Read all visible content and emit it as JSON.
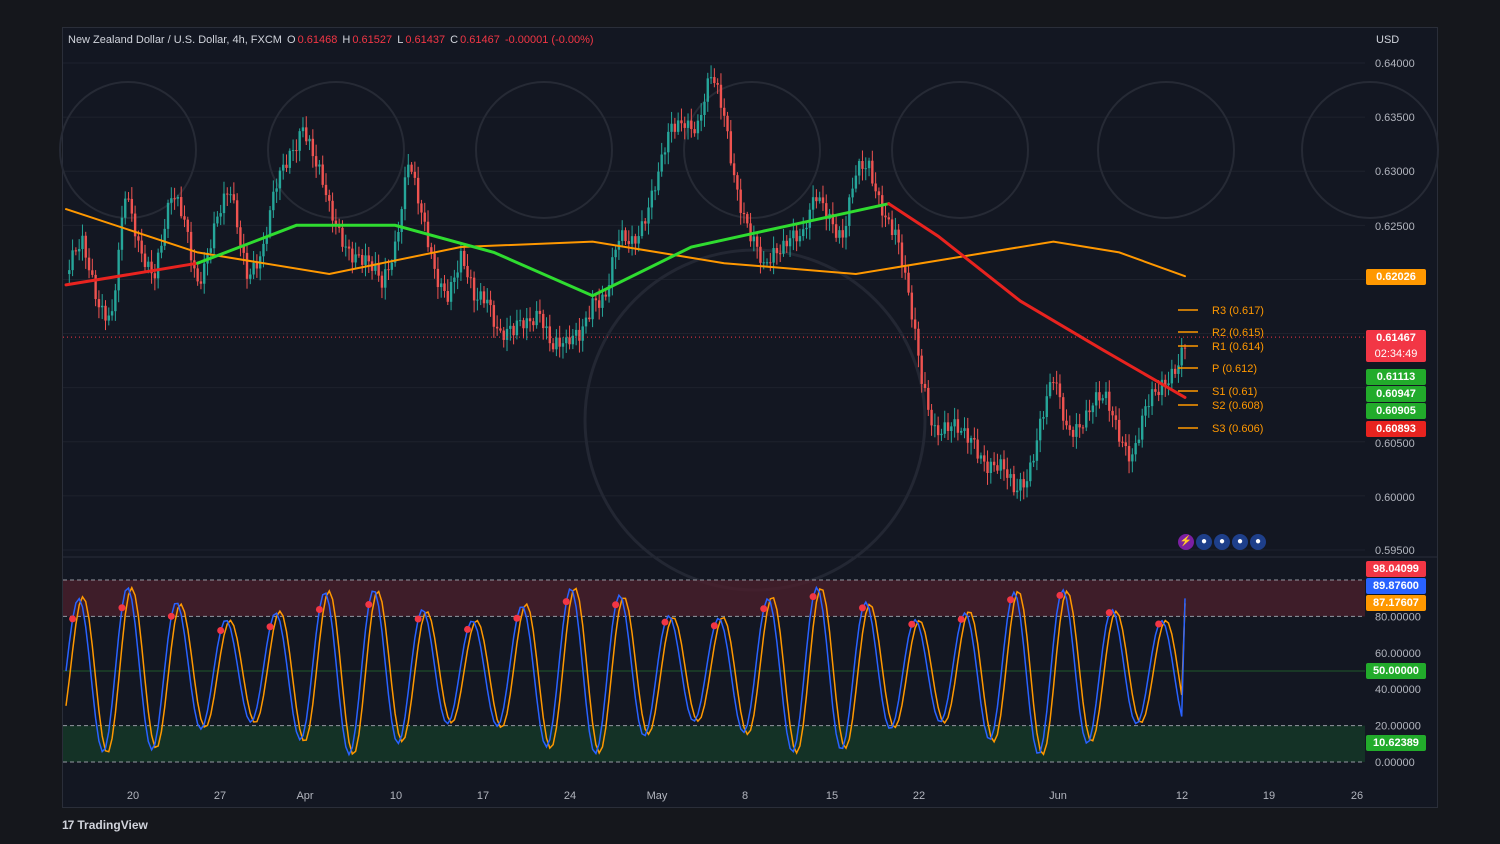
{
  "header": {
    "symbol": "New Zealand Dollar / U.S. Dollar, 4h, FXCM",
    "open_label": "O",
    "open": "0.61468",
    "high_label": "H",
    "high": "0.61527",
    "low_label": "L",
    "low": "0.61437",
    "close_label": "C",
    "close": "0.61467",
    "change": "-0.00001 (-0.00%)"
  },
  "currency": "USD",
  "branding": "TradingView",
  "colors": {
    "background": "#131722",
    "up": "#26a69a",
    "down": "#ef5350",
    "ma_green": "#2fdc30",
    "ma_red": "#e8231f",
    "ma_orange": "#ff9800",
    "stoch_k": "#2962ff",
    "stoch_d": "#ff9800",
    "overbought_zone": "#4a1f2c",
    "oversold_zone": "#153a28"
  },
  "price_axis": {
    "ticks": [
      "0.64000",
      "0.63500",
      "0.63000",
      "0.62500",
      "0.62000",
      "0.61500",
      "0.61000",
      "0.60500",
      "0.60000",
      "0.59500"
    ],
    "labels": [
      "0.64000",
      "0.63500",
      "0.63000",
      "0.62500",
      "0.60500",
      "0.60000",
      "0.59500"
    ]
  },
  "price_badges": [
    {
      "label": "0.62026",
      "color": "#ff9800"
    },
    {
      "label": "0.61467",
      "sub": "02:34:49",
      "color": "#f23645"
    },
    {
      "label": "0.61113",
      "color": "#22ab2b"
    },
    {
      "label": "0.60947",
      "color": "#22ab2b"
    },
    {
      "label": "0.60905",
      "color": "#22ab2b"
    },
    {
      "label": "0.60893",
      "color": "#e8231f"
    }
  ],
  "pivots": [
    {
      "name": "R3",
      "label": "R3 (0.617)",
      "value": 0.617
    },
    {
      "name": "R2",
      "label": "R2 (0.615)",
      "value": 0.615
    },
    {
      "name": "R1",
      "label": "R1 (0.614)",
      "value": 0.614
    },
    {
      "name": "P",
      "label": "P (0.612)",
      "value": 0.612
    },
    {
      "name": "S1",
      "label": "S1 (0.61)",
      "value": 0.61
    },
    {
      "name": "S2",
      "label": "S2 (0.608)",
      "value": 0.608
    },
    {
      "name": "S3",
      "label": "S3 (0.606)",
      "value": 0.606
    }
  ],
  "stoch_axis": {
    "labels": [
      "80.00000",
      "60.00000",
      "40.00000",
      "20.00000",
      "0.00000"
    ]
  },
  "stoch_badges": [
    {
      "label": "98.04099",
      "color": "#f23645"
    },
    {
      "label": "89.87600",
      "color": "#2962ff"
    },
    {
      "label": "87.17607",
      "color": "#ff9800"
    },
    {
      "label": "50.00000",
      "color": "#22ab2b"
    },
    {
      "label": "10.62389",
      "color": "#22ab2b"
    }
  ],
  "time_axis": [
    "20",
    "27",
    "Apr",
    "10",
    "17",
    "24",
    "May",
    "8",
    "15",
    "22",
    "Jun",
    "12",
    "19",
    "26"
  ],
  "chart_data": {
    "type": "candlestick",
    "title": "New Zealand Dollar / U.S. Dollar, 4h, FXCM",
    "ylim": [
      0.5945,
      0.6405
    ],
    "x_labels": [
      "20",
      "27",
      "Apr",
      "10",
      "17",
      "24",
      "May",
      "8",
      "15",
      "22",
      "Jun",
      "12",
      "19",
      "26"
    ],
    "close_path": [
      [
        0,
        0.6205
      ],
      [
        5,
        0.6225
      ],
      [
        10,
        0.6185
      ],
      [
        14,
        0.617
      ],
      [
        18,
        0.627
      ],
      [
        22,
        0.623
      ],
      [
        27,
        0.6215
      ],
      [
        32,
        0.627
      ],
      [
        36,
        0.625
      ],
      [
        40,
        0.6205
      ],
      [
        45,
        0.6245
      ],
      [
        50,
        0.6275
      ],
      [
        55,
        0.6215
      ],
      [
        60,
        0.6225
      ],
      [
        64,
        0.628
      ],
      [
        68,
        0.632
      ],
      [
        72,
        0.635
      ],
      [
        76,
        0.63
      ],
      [
        80,
        0.626
      ],
      [
        84,
        0.6245
      ],
      [
        88,
        0.6225
      ],
      [
        92,
        0.6205
      ],
      [
        96,
        0.6195
      ],
      [
        100,
        0.624
      ],
      [
        104,
        0.631
      ],
      [
        108,
        0.625
      ],
      [
        112,
        0.621
      ],
      [
        116,
        0.6195
      ],
      [
        120,
        0.6215
      ],
      [
        124,
        0.6175
      ],
      [
        128,
        0.619
      ],
      [
        132,
        0.6155
      ],
      [
        136,
        0.6145
      ],
      [
        140,
        0.6155
      ],
      [
        144,
        0.618
      ],
      [
        148,
        0.614
      ],
      [
        152,
        0.613
      ],
      [
        156,
        0.615
      ],
      [
        160,
        0.619
      ],
      [
        164,
        0.618
      ],
      [
        168,
        0.623
      ],
      [
        172,
        0.624
      ],
      [
        176,
        0.6265
      ],
      [
        180,
        0.629
      ],
      [
        184,
        0.6335
      ],
      [
        188,
        0.6355
      ],
      [
        192,
        0.6345
      ],
      [
        196,
        0.638
      ],
      [
        200,
        0.635
      ],
      [
        204,
        0.629
      ],
      [
        208,
        0.624
      ],
      [
        212,
        0.62
      ],
      [
        216,
        0.623
      ],
      [
        220,
        0.625
      ],
      [
        224,
        0.6235
      ],
      [
        228,
        0.627
      ],
      [
        232,
        0.6265
      ],
      [
        236,
        0.6245
      ],
      [
        240,
        0.629
      ],
      [
        244,
        0.63
      ],
      [
        248,
        0.6275
      ],
      [
        252,
        0.6245
      ],
      [
        256,
        0.6175
      ],
      [
        260,
        0.611
      ],
      [
        264,
        0.607
      ],
      [
        268,
        0.606
      ],
      [
        272,
        0.605
      ],
      [
        276,
        0.6055
      ],
      [
        280,
        0.6035
      ],
      [
        284,
        0.602
      ],
      [
        288,
        0.6
      ],
      [
        292,
        0.6025
      ],
      [
        296,
        0.607
      ],
      [
        300,
        0.61
      ],
      [
        304,
        0.606
      ],
      [
        308,
        0.6075
      ],
      [
        312,
        0.6085
      ],
      [
        316,
        0.608
      ],
      [
        320,
        0.606
      ],
      [
        324,
        0.6045
      ],
      [
        328,
        0.6075
      ],
      [
        332,
        0.609
      ],
      [
        336,
        0.612
      ],
      [
        340,
        0.6147
      ]
    ],
    "moving_averages": [
      {
        "name": "long",
        "color": "#ff9800",
        "path": [
          [
            0,
            0.6265
          ],
          [
            40,
            0.6225
          ],
          [
            80,
            0.6205
          ],
          [
            120,
            0.623
          ],
          [
            160,
            0.6235
          ],
          [
            200,
            0.6215
          ],
          [
            240,
            0.6205
          ],
          [
            280,
            0.6225
          ],
          [
            300,
            0.6235
          ],
          [
            320,
            0.6225
          ],
          [
            340,
            0.6203
          ]
        ]
      },
      {
        "name": "mid",
        "path": [
          [
            0,
            0.6195
          ],
          [
            40,
            0.6215
          ],
          [
            70,
            0.625
          ],
          [
            100,
            0.625
          ],
          [
            130,
            0.6225
          ],
          [
            160,
            0.6185
          ],
          [
            190,
            0.623
          ],
          [
            220,
            0.625
          ],
          [
            250,
            0.627
          ],
          [
            265,
            0.624
          ],
          [
            290,
            0.618
          ],
          [
            315,
            0.6135
          ],
          [
            340,
            0.6091
          ]
        ]
      }
    ],
    "stochastic": {
      "overbought": 80,
      "oversold": 20,
      "mid": 50,
      "ylim": [
        0,
        100
      ],
      "k_last": 89.876,
      "d_last": 87.17607
    }
  }
}
